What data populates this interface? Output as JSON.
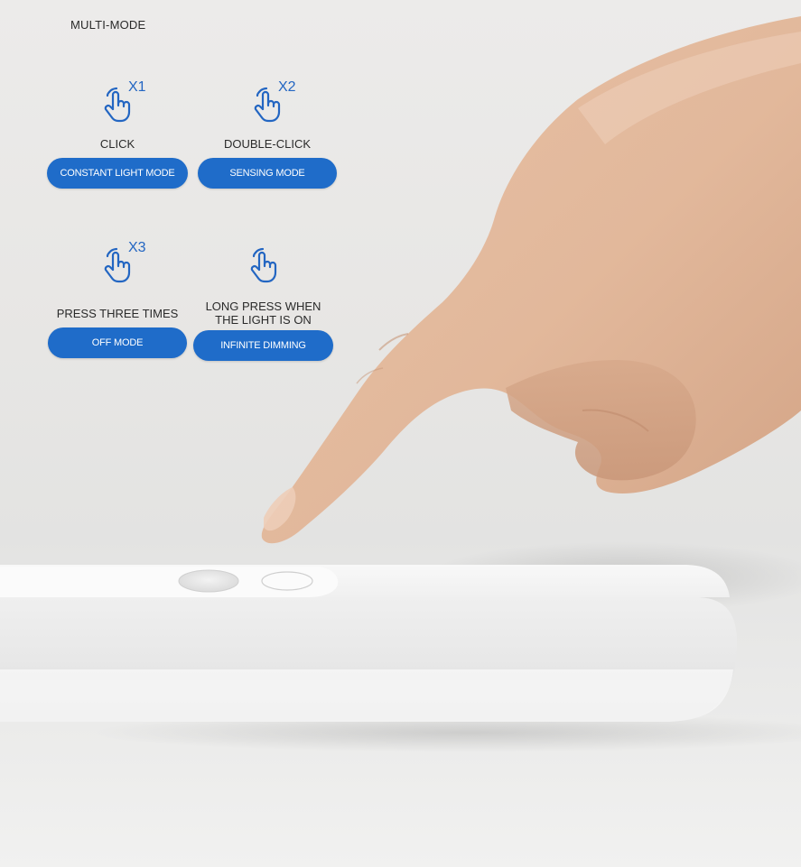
{
  "heading": "MULTI-MODE",
  "modes": [
    {
      "icon": "hand-tap-icon",
      "multiplier": "X1",
      "action": "CLICK",
      "mode": "CONSTANT LIGHT MODE"
    },
    {
      "icon": "hand-tap-icon",
      "multiplier": "X2",
      "action": "DOUBLE-CLICK",
      "mode": "SENSING MODE"
    },
    {
      "icon": "hand-tap-icon",
      "multiplier": "X3",
      "action": "PRESS THREE TIMES",
      "mode": "OFF MODE"
    },
    {
      "icon": "hand-tap-icon",
      "multiplier": "",
      "action_line1": "LONG PRESS WHEN",
      "action_line2": "THE LIGHT IS ON",
      "mode": "INFINITE DIMMING"
    }
  ],
  "colors": {
    "accent": "#1f6cc9",
    "multiplier_text": "#2366c2",
    "background": "#e8e7e5",
    "device_body": "#f4f4f4"
  }
}
